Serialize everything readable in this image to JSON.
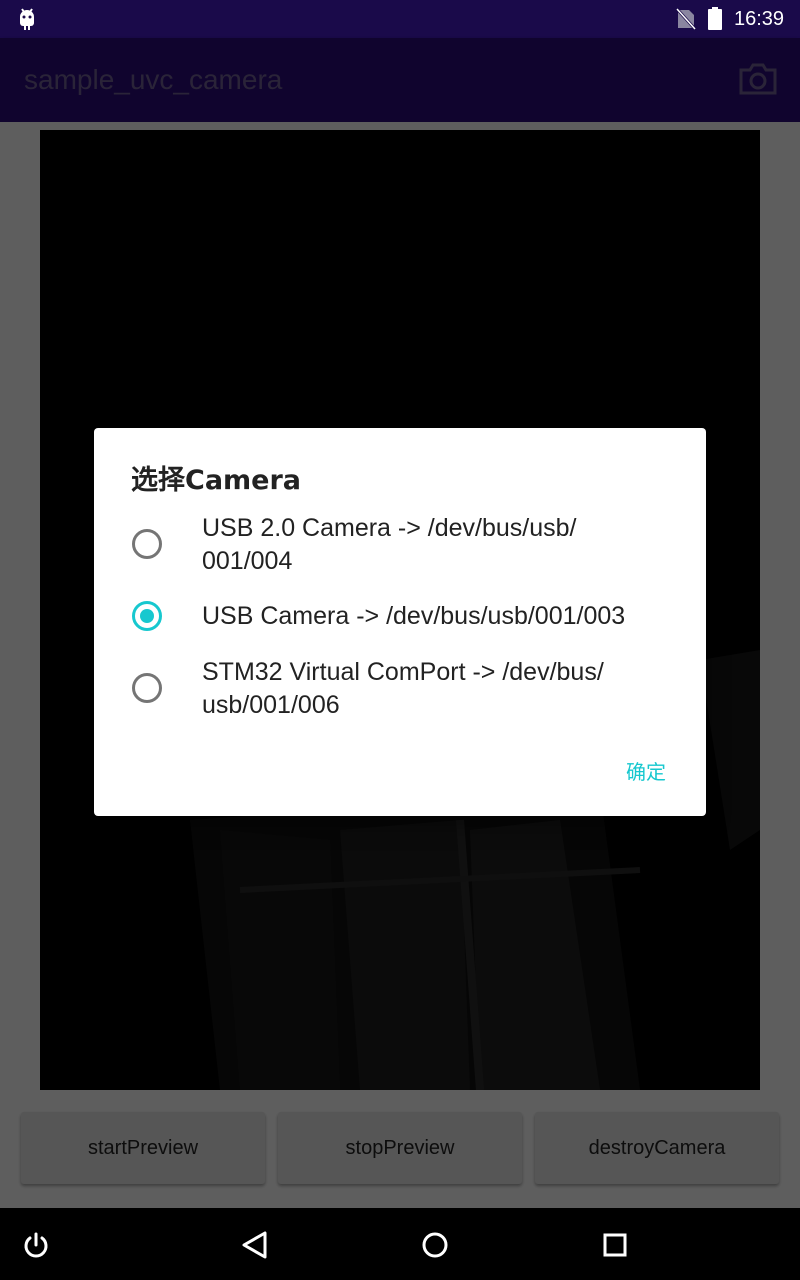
{
  "status_bar": {
    "time": "16:39",
    "icons": [
      "android-debug-icon",
      "no-sim-icon",
      "battery-full-icon"
    ]
  },
  "app_bar": {
    "title": "sample_uvc_camera",
    "action_icon": "camera-icon"
  },
  "buttons": {
    "start": "startPreview",
    "stop": "stopPreview",
    "destroy": "destroyCamera"
  },
  "dialog": {
    "title": "选择Camera",
    "options": [
      {
        "line1": "USB 2.0 Camera -> /dev/bus/usb/",
        "line2": "001/004",
        "checked": false
      },
      {
        "line1": "USB Camera -> /dev/bus/usb/001/003",
        "line2": "",
        "checked": true
      },
      {
        "line1": "STM32 Virtual ComPort -> /dev/bus/",
        "line2": "usb/001/006",
        "checked": false
      }
    ],
    "ok_label": "确定"
  },
  "nav_bar": {
    "icons": [
      "power-icon",
      "back-icon",
      "home-icon",
      "recents-icon"
    ]
  },
  "colors": {
    "status_bar": "#1a0a4a",
    "app_bar": "#280c73",
    "accent": "#17c8cf"
  }
}
